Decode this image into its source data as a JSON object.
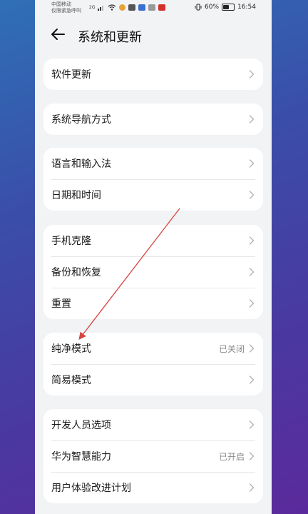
{
  "status_bar": {
    "carrier_line1": "中国移动",
    "carrier_line2": "仅限紧急呼叫",
    "network": "2G",
    "battery_percent": "60%",
    "battery_level": 0.6,
    "time": "16:54"
  },
  "header": {
    "title": "系统和更新"
  },
  "groups": [
    {
      "items": [
        {
          "label": "软件更新",
          "value": ""
        }
      ]
    },
    {
      "items": [
        {
          "label": "系统导航方式",
          "value": ""
        }
      ]
    },
    {
      "items": [
        {
          "label": "语言和输入法",
          "value": ""
        },
        {
          "label": "日期和时间",
          "value": ""
        }
      ]
    },
    {
      "items": [
        {
          "label": "手机克隆",
          "value": ""
        },
        {
          "label": "备份和恢复",
          "value": ""
        },
        {
          "label": "重置",
          "value": ""
        }
      ]
    },
    {
      "items": [
        {
          "label": "纯净模式",
          "value": "已关闭"
        },
        {
          "label": "简易模式",
          "value": ""
        }
      ]
    },
    {
      "items": [
        {
          "label": "开发人员选项",
          "value": ""
        },
        {
          "label": "华为智慧能力",
          "value": "已开启"
        },
        {
          "label": "用户体验改进计划",
          "value": ""
        }
      ]
    }
  ],
  "colors": {
    "annotation_arrow": "#d64541"
  }
}
